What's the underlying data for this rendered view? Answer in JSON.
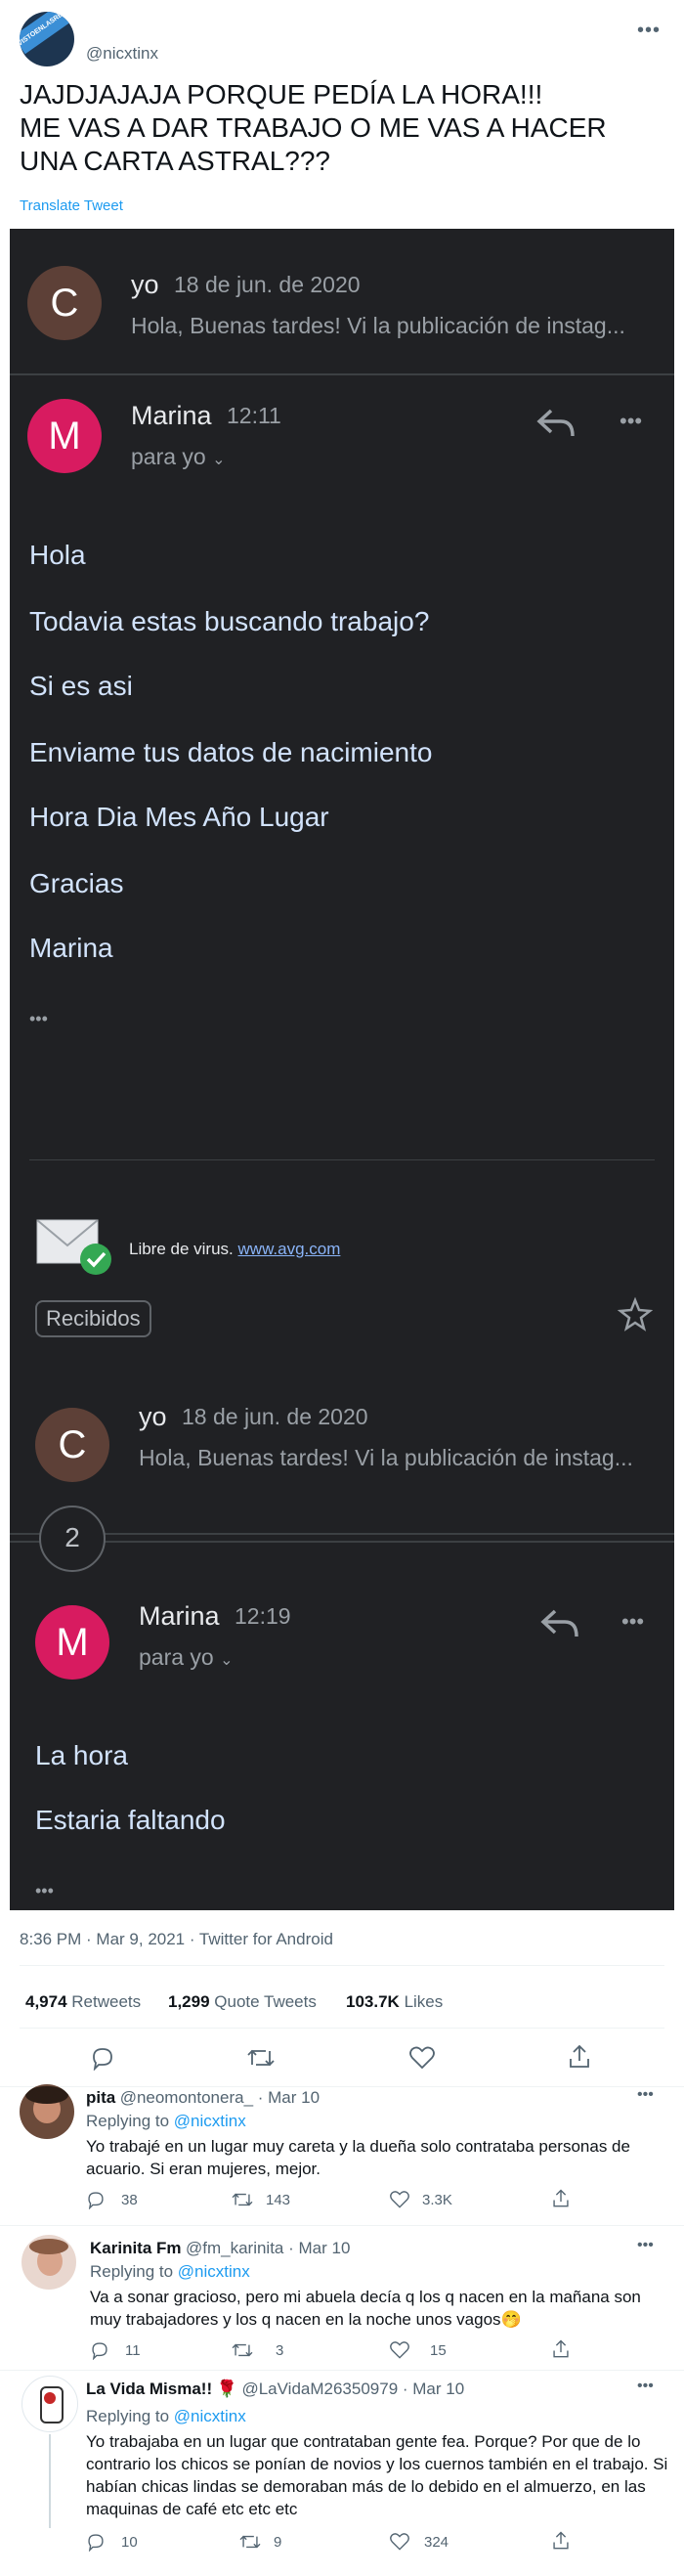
{
  "tweet": {
    "handle": "@nicxtinx",
    "avatar_text": "VISTOENLASREDES.COM",
    "text": "JAJDJAJAJA PORQUE PEDÍA LA HORA!!!\nME VAS A DAR TRABAJO O ME VAS A HACER UNA CARTA ASTRAL???",
    "translate": "Translate Tweet",
    "meta": "8:36 PM · Mar 9, 2021 · Twitter for Android",
    "retweets": "4,974",
    "retweets_label": "Retweets",
    "quotes": "1,299",
    "quotes_label": "Quote Tweets",
    "likes": "103.7K",
    "likes_label": "Likes"
  },
  "email": {
    "msg1": {
      "initial": "C",
      "sender": "yo",
      "date": "18 de jun. de 2020",
      "snippet": "Hola, Buenas tardes! Vi la publicación de instag..."
    },
    "msg2": {
      "initial": "M",
      "sender": "Marina",
      "time": "12:11",
      "to": "para yo",
      "body": [
        "Hola",
        "Todavia estas buscando trabajo?",
        "Si es asi",
        "Enviame tus datos de nacimiento",
        "Hora Dia Mes Año Lugar",
        "Gracias",
        "Marina"
      ],
      "ellipsis": "•••"
    },
    "virus_text": "Libre de virus.",
    "virus_link": "www.avg.com",
    "label": "Recibidos",
    "msg3": {
      "initial": "C",
      "sender": "yo",
      "date": "18 de jun. de 2020",
      "snippet": "Hola, Buenas tardes! Vi la publicación de instag..."
    },
    "collapsed_count": "2",
    "msg4": {
      "initial": "M",
      "sender": "Marina",
      "time": "12:19",
      "to": "para yo",
      "body": [
        "La hora",
        "Estaria faltando"
      ],
      "ellipsis": "•••"
    }
  },
  "replies": [
    {
      "name": "pita",
      "handle": "@neomontonera_ · Mar 10",
      "replying_prefix": "Replying to",
      "replying_to": "@nicxtinx",
      "text": "Yo trabajé en un lugar muy careta y la dueña solo contrataba personas de acuario. Si eran mujeres, mejor.",
      "replies": "38",
      "retweets": "143",
      "likes": "3.3K"
    },
    {
      "name": "Karinita Fm",
      "handle": "@fm_karinita · Mar 10",
      "replying_prefix": "Replying to",
      "replying_to": "@nicxtinx",
      "text": "Va a sonar gracioso, pero mi abuela decía q los q nacen en la mañana son muy trabajadores y los q nacen en la noche unos vagos🤭",
      "replies": "11",
      "retweets": "3",
      "likes": "15"
    },
    {
      "name": "La Vida Misma!! 🌹",
      "handle": "@LaVidaM26350979 · Mar 10",
      "replying_prefix": "Replying to",
      "replying_to": "@nicxtinx",
      "text": "Yo trabajaba en un lugar que contrataban gente fea. Porque?  Por que de lo contrario los chicos se ponían de novios y los cuernos también en el trabajo.  Si habían chicas lindas se demoraban más de lo debido en el almuerzo,  en las maquinas de café etc etc etc",
      "replies": "10",
      "retweets": "9",
      "likes": "324"
    }
  ],
  "colors": {
    "dark_bg": "#202124",
    "link": "#1d9bf0",
    "m_avatar": "#d81b60",
    "c_avatar": "#5d4037"
  },
  "icons": [
    "reply-icon",
    "retweet-icon",
    "like-icon",
    "share-icon",
    "more-icon",
    "star-icon"
  ]
}
